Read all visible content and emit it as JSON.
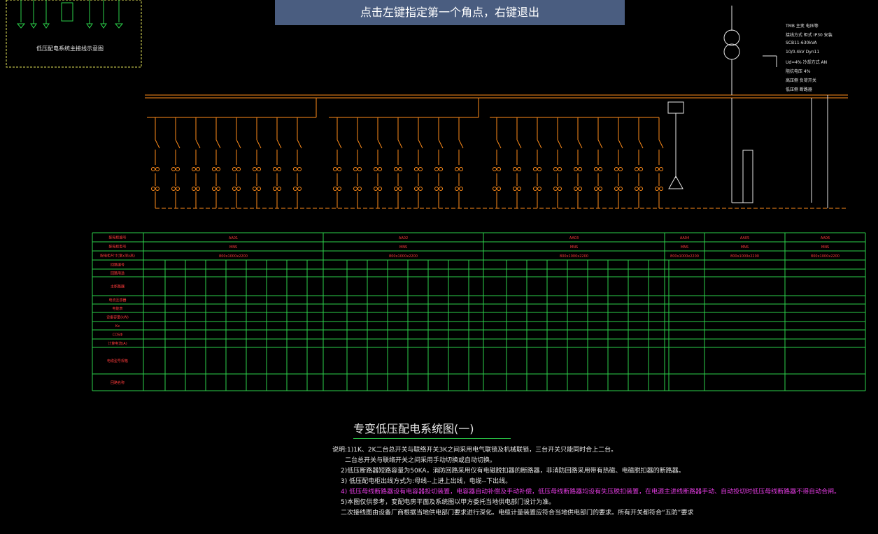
{
  "command_prompt": "点击左键指定第一个角点，右键退出",
  "drawing_title": "专变低压配电系统图(一)",
  "legend_box_label": "低压配电系统主接线示意图",
  "transformer_notes": [
    "TMB 主变  电压等",
    "接线方式 柜式 IP30 安装",
    "SCB11-630kVA",
    "10/0.4kV Dyn11",
    "Ud=4% 冷却方式 AN",
    "阻抗电压 4%",
    "高压侧 负荷开关",
    "低压侧 断路器"
  ],
  "notes": {
    "n1": "说明:1)1K、2K二台总开关与联络开关3K之间采用电气联锁及机械联锁，三台开关只能同时合上二台。",
    "n1b": "二台总开关与联络开关之间采用手动切换或自动切换。",
    "n2": "2)低压断路器短路容量为50KA，消防回路采用仅有电磁脱扣器的断路器，非消防回路采用带有热磁、电磁脱扣器的断路器。",
    "n3": "3) 低压配电柜出线方式为:母线--上进上出线，电缆--下出线。",
    "n4": "4) 低压母线断路器设有电容器投切装置，电容器自动补偿及手动补偿，低压母线断路器均设有失压脱扣装置，在电源主进线断路器手动、自动投切时低压母线断路器不得自动合闸。",
    "n5": "5)本图仅供参考，变配电房平面及系统图以甲方委托当地供电部门设计为准。",
    "n5b": "二次接线图由设备厂商根据当地供电部门要求进行深化。电缆计量装置应符合当地供电部门的要求。所有开关都符合“五防”要求"
  },
  "table": {
    "header_rows": [
      "配电柜编号",
      "配电柜型号",
      "配电柜尺寸(宽x深x高)",
      "回路编号",
      "回路用途",
      "主断路器",
      "电流互感器",
      "电能表",
      "设备容量(kW)",
      "Kx",
      "COSΦ",
      "计算电流(A)",
      "电缆型号规格",
      "回路名称"
    ],
    "cabinet_groups": [
      "AA01",
      "AA02",
      "AA03",
      "AA04",
      "AA05",
      "AA06"
    ],
    "cabinet_type": "MNS",
    "cabinet_size": "800x1000x2200"
  },
  "colors": {
    "background": "#000000",
    "bus": "#ff8c1a",
    "table_grid": "#2bd14a",
    "table_text": "#ff3b3b",
    "prompt_bg": "#4a5d80",
    "legend_box": "#e8e85a"
  }
}
